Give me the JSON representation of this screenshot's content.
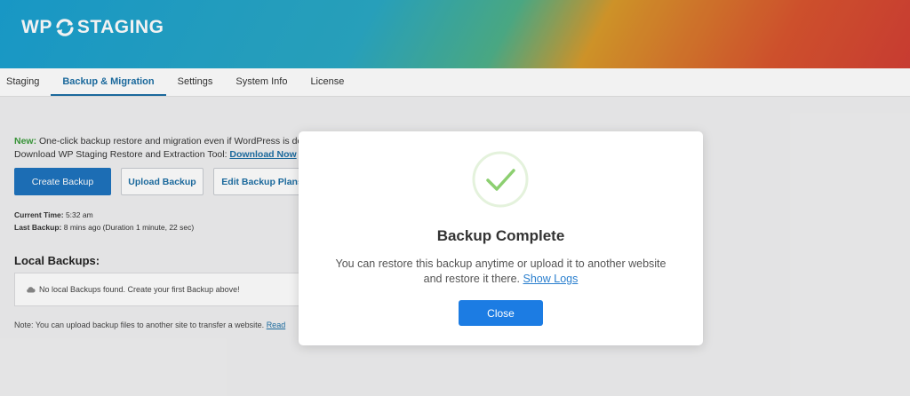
{
  "header": {
    "logo_left": "WP",
    "logo_right": "STAGING"
  },
  "tabs": [
    {
      "label": "Staging"
    },
    {
      "label": "Backup & Migration"
    },
    {
      "label": "Settings"
    },
    {
      "label": "System Info"
    },
    {
      "label": "License"
    }
  ],
  "notice": {
    "new_label": "New:",
    "line1": " One-click backup restore and migration even if WordPress is do",
    "line2": "Download WP Staging Restore and Extraction Tool: ",
    "download_link": "Download Now"
  },
  "buttons": {
    "create": "Create Backup",
    "upload": "Upload Backup",
    "plans": "Edit Backup Plans"
  },
  "meta": {
    "current_time_label": "Current Time:",
    "current_time_value": " 5:32 am",
    "last_backup_label": "Last Backup:",
    "last_backup_value": " 8 mins ago (Duration 1 minute, 22 sec)"
  },
  "local_backups": {
    "title": "Local Backups:",
    "empty_message": "No local Backups found. Create your first Backup above!"
  },
  "note": {
    "text": "Note: You can upload backup files to another site to transfer a website. ",
    "link": "Read"
  },
  "modal": {
    "title": "Backup Complete",
    "text_line1": "You can restore this backup anytime or upload it to another website",
    "text_line2": "and restore it there. ",
    "logs_link": "Show Logs",
    "close_label": "Close",
    "check_color": "#8ccf70"
  }
}
